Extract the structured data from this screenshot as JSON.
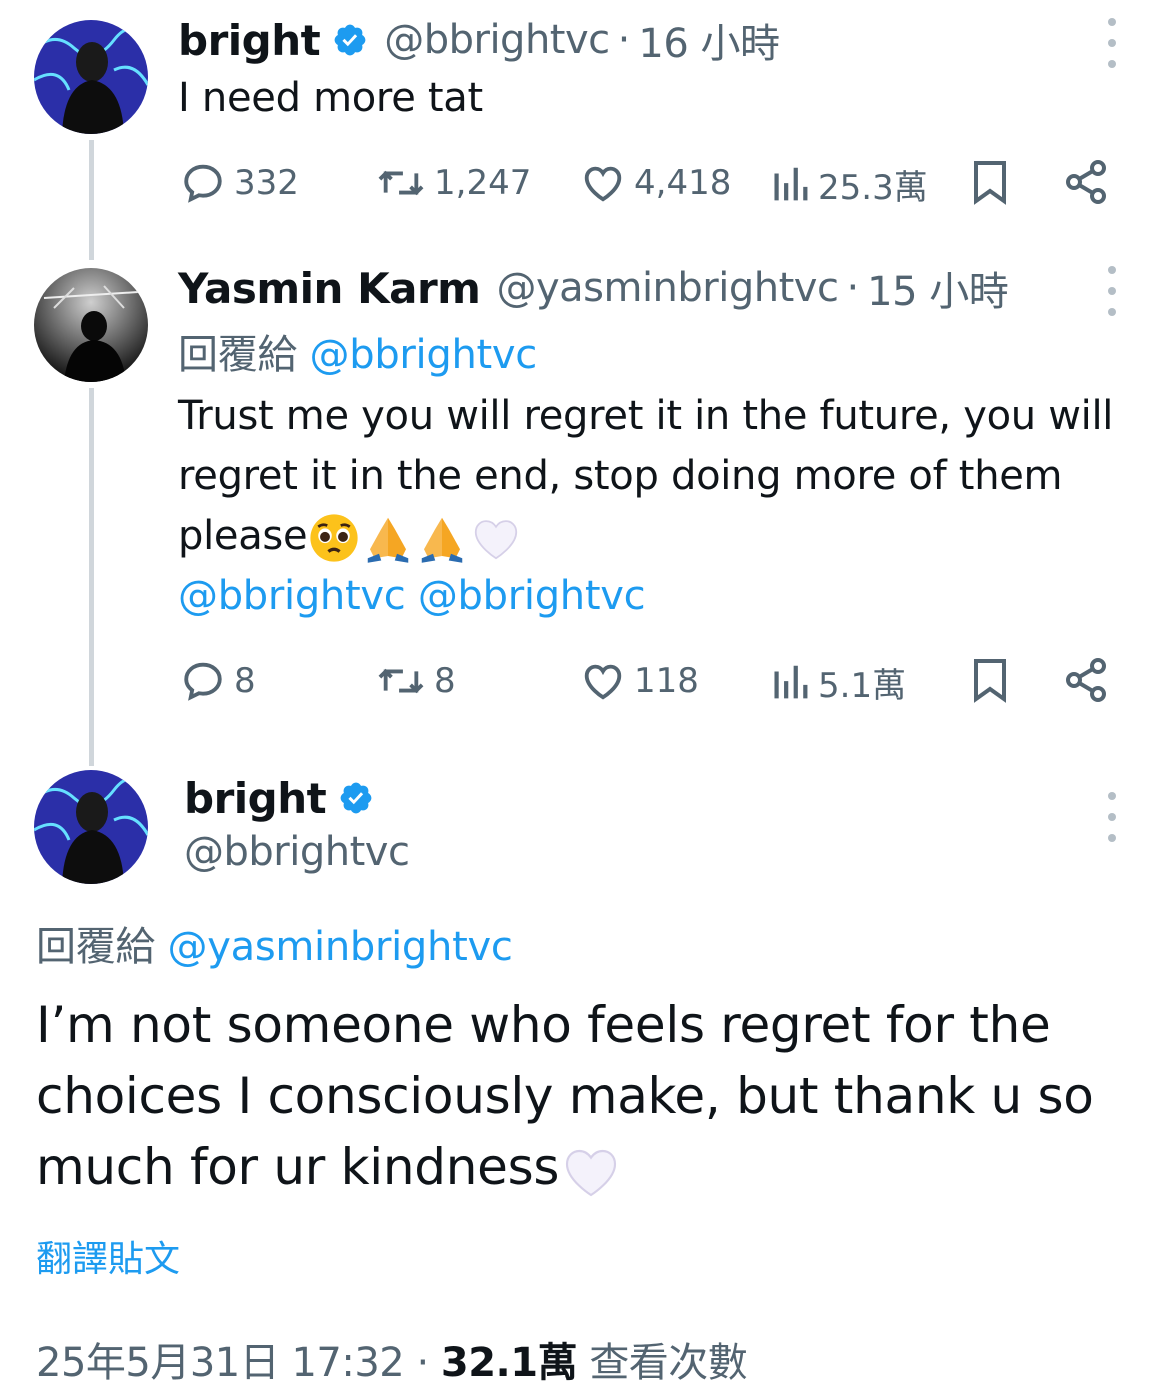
{
  "tweet1": {
    "name": "bright",
    "handle": "@bbrightvc",
    "separator": "·",
    "time": "16 小時",
    "text": "I need more tat",
    "stats": {
      "replies": "332",
      "reposts": "1,247",
      "likes": "4,418",
      "views": "25.3萬"
    }
  },
  "tweet2": {
    "name": "Yasmin Karm",
    "handle": "@yasminbrightvc",
    "separator": "·",
    "time": "15 小時",
    "reply_label": "回覆給",
    "reply_target": "@bbrightvc",
    "text_line1": "Trust me you will regret it in the future, you will",
    "text_line2": "regret it in the end, stop doing more of them",
    "text_line3": "please",
    "emojis": [
      "pleading-face",
      "folded-hands",
      "folded-hands",
      "white-heart"
    ],
    "mentions": [
      "@bbrightvc",
      "@bbrightvc"
    ],
    "stats": {
      "replies": "8",
      "reposts": "8",
      "likes": "118",
      "views": "5.1萬"
    }
  },
  "tweet3": {
    "name": "bright",
    "handle": "@bbrightvc",
    "reply_label": "回覆給",
    "reply_target": "@yasminbrightvc",
    "text_line1": "I’m not someone who feels regret for the",
    "text_line2": "choices I consciously make, but thank u so",
    "text_line3": "much for ur kindness",
    "translate_label": "翻譯貼文",
    "date": "25年5月31日 17:32",
    "separator": "·",
    "view_count": "32.1萬",
    "view_label": "查看次數"
  },
  "colors": {
    "accent": "#1d9bf0",
    "secondary_text": "#536471",
    "thread_line": "#d0d6db"
  }
}
